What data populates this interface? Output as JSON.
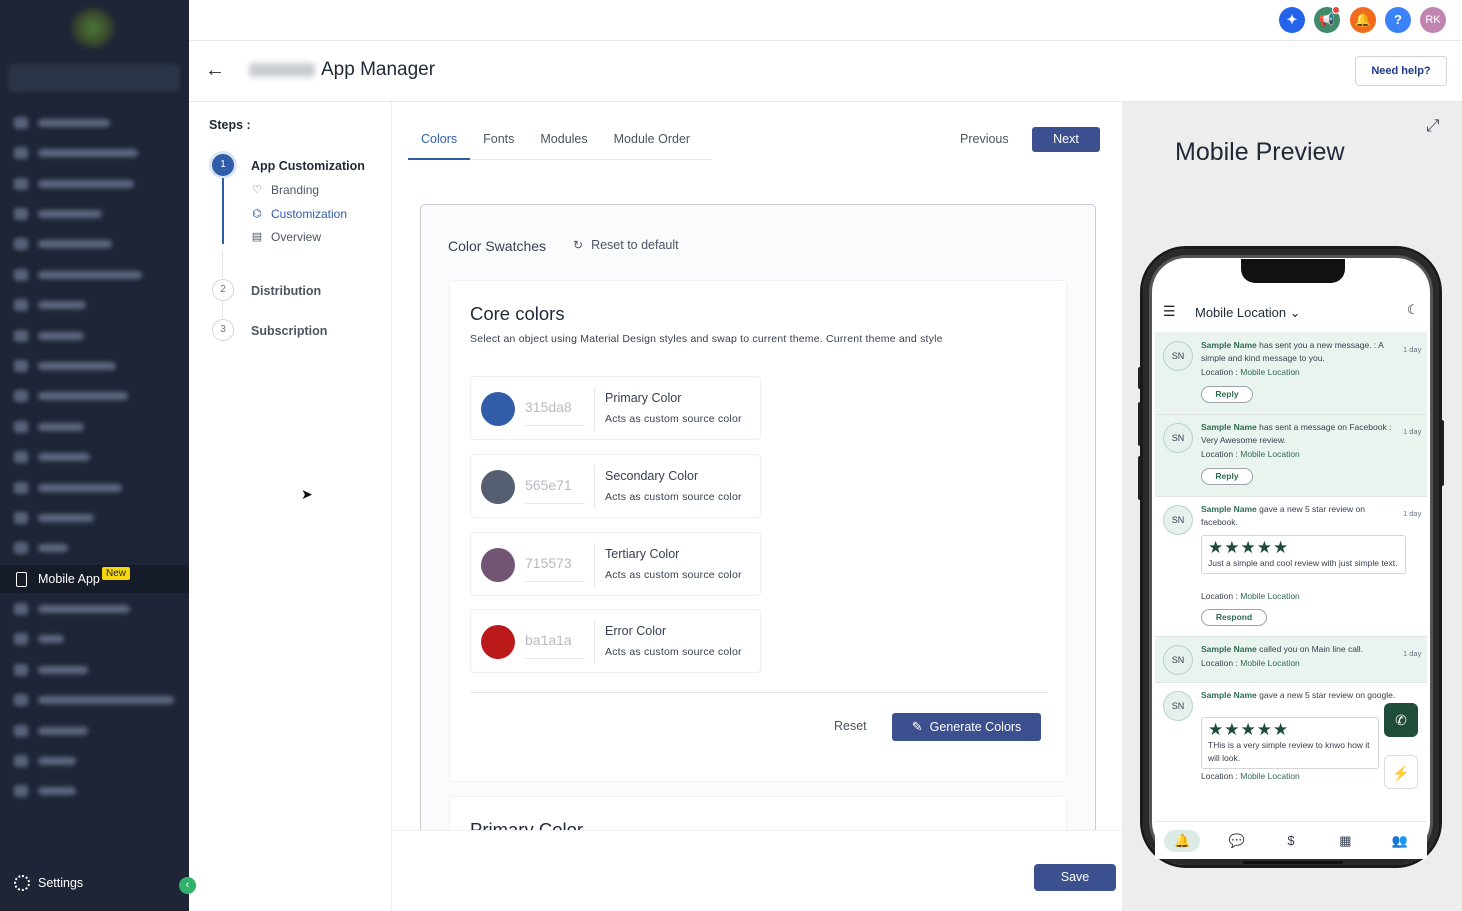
{
  "sidebar": {
    "active_item": {
      "label": "Mobile App",
      "badge": "New"
    },
    "settings_label": "Settings"
  },
  "topbar": {
    "avatar_initials": "RK",
    "help_glyph": "?"
  },
  "header": {
    "title": "App Manager",
    "help_button": "Need help?"
  },
  "steps": {
    "title": "Steps :",
    "items": [
      {
        "num": "1",
        "label": "App Customization"
      },
      {
        "num": "2",
        "label": "Distribution"
      },
      {
        "num": "3",
        "label": "Subscription"
      }
    ],
    "sub_items": [
      {
        "label": "Branding"
      },
      {
        "label": "Customization"
      },
      {
        "label": "Overview"
      }
    ]
  },
  "tabs": [
    {
      "label": "Colors"
    },
    {
      "label": "Fonts"
    },
    {
      "label": "Modules"
    },
    {
      "label": "Module Order"
    }
  ],
  "nav": {
    "previous": "Previous",
    "next": "Next"
  },
  "swatches": {
    "title": "Color Swatches",
    "reset_default": "Reset to default"
  },
  "core": {
    "title": "Core colors",
    "subtitle": "Select an object using Material Design styles and swap to current theme. Current theme and style",
    "colors": [
      {
        "hex": "315da8",
        "name": "Primary Color",
        "desc": "Acts as custom source color",
        "swatch": "#315da8"
      },
      {
        "hex": "565e71",
        "name": "Secondary Color",
        "desc": "Acts as custom source color",
        "swatch": "#565e71"
      },
      {
        "hex": "715573",
        "name": "Tertiary Color",
        "desc": "Acts as custom source color",
        "swatch": "#715573"
      },
      {
        "hex": "ba1a1a",
        "name": "Error Color",
        "desc": "Acts as custom source color",
        "swatch": "#ba1a1a"
      }
    ],
    "reset": "Reset",
    "generate": "Generate Colors"
  },
  "primary_section": {
    "title": "Primary Color"
  },
  "footer": {
    "save": "Save"
  },
  "preview": {
    "title": "Mobile Preview",
    "location": "Mobile Location",
    "avatar": "SN",
    "notifications": [
      {
        "name": "Sample Name",
        "text": " has sent you a new message. : A simple and kind message to you.",
        "time": "1 day",
        "loc_label": "Location : ",
        "loc": "Mobile Location",
        "button": "Reply"
      },
      {
        "name": "Sample Name",
        "text": " has sent a message on Facebook : Very Awesome review.",
        "time": "1 day",
        "loc_label": "Location : ",
        "loc": "Mobile Location",
        "button": "Reply"
      },
      {
        "name": "Sample Name",
        "text": " gave a new 5 star review on facebook.",
        "time": "1 day",
        "review": "Just a simple and cool review with just simple text.",
        "loc_label": "Location : ",
        "loc": "Mobile Location",
        "button": "Respond"
      },
      {
        "name": "Sample Name",
        "text": " called you on Main line call.",
        "time": "1 day",
        "loc_label": "Location : ",
        "loc": "Mobile Location"
      },
      {
        "name": "Sample Name",
        "text": " gave a new 5 star review on google.",
        "review": "THis is a very simple review to knwo how it will look.",
        "loc_label": "Location : ",
        "loc": "Mobile Location"
      }
    ],
    "stars": "★★★★★"
  },
  "colors": {
    "accent": "#315da8",
    "button": "#3c4f8e",
    "sidebar": "#1e2536",
    "new_badge": "#f5d60a"
  }
}
